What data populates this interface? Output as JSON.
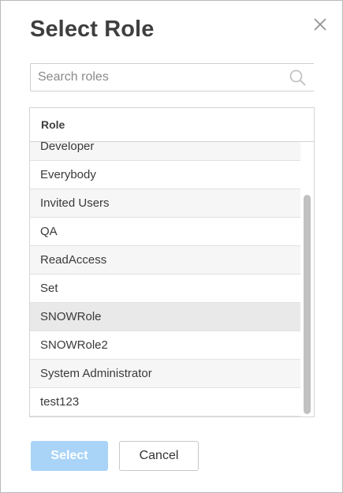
{
  "dialog": {
    "title": "Select Role",
    "close_icon": "close-icon"
  },
  "search": {
    "placeholder": "Search roles",
    "value": "",
    "icon": "search-icon"
  },
  "table": {
    "column_header": "Role",
    "rows": [
      {
        "label": "Developer"
      },
      {
        "label": "Everybody"
      },
      {
        "label": "Invited Users"
      },
      {
        "label": "QA"
      },
      {
        "label": "ReadAccess"
      },
      {
        "label": "Set"
      },
      {
        "label": "SNOWRole",
        "state": "hovered"
      },
      {
        "label": "SNOWRole2"
      },
      {
        "label": "System Administrator"
      },
      {
        "label": "test123"
      }
    ]
  },
  "footer": {
    "select_label": "Select",
    "select_state": "disabled",
    "cancel_label": "Cancel"
  },
  "colors": {
    "select_button_disabled": "#a9d4f7",
    "row_alt": "#f6f6f6",
    "row_hover": "#e9e9e9",
    "title_text": "#3f3f3f"
  }
}
